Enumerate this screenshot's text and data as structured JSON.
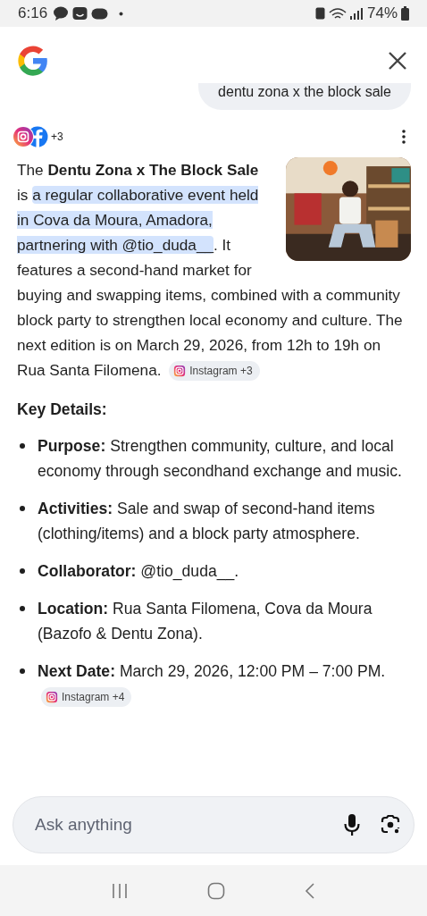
{
  "status_bar": {
    "time": "6:16",
    "battery": "74%"
  },
  "query": "dentu zona x the block sale",
  "sources": {
    "count": "+3"
  },
  "answer": {
    "segments": [
      {
        "kind": "plain",
        "text": "The "
      },
      {
        "kind": "bold",
        "text": "Dentu Zona x The Block Sale"
      },
      {
        "kind": "plain",
        "text": " is "
      },
      {
        "kind": "highlight",
        "text": "a regular collaborative event held in Cova da Moura, Amadora, partnering with @tio_duda__"
      },
      {
        "kind": "plain",
        "text": ". It features a second-hand market for buying and swapping items, combined with a community block party to strengthen local economy and culture. The next edition is on March 29, 2026, from 12h to 19h on Rua Santa Filomena."
      }
    ],
    "chip": "Instagram +3"
  },
  "heading": "Key Details:",
  "details": [
    {
      "label": "Purpose:",
      "text": "Strengthen community, culture, and local economy through secondhand exchange and music."
    },
    {
      "label": "Activities:",
      "text": "Sale and swap of second-hand items (clothing/items) and a block party atmosphere."
    },
    {
      "label": "Collaborator:",
      "text": "@tio_duda__."
    },
    {
      "label": "Location:",
      "text": "Rua Santa Filomena, Cova da Moura (Bazofo & Dentu Zona)."
    },
    {
      "label": "Next Date:",
      "text": "March 29, 2026, 12:00 PM – 7:00 PM.",
      "chip": "Instagram +4"
    }
  ],
  "ask_field": {
    "placeholder": "Ask anything"
  }
}
